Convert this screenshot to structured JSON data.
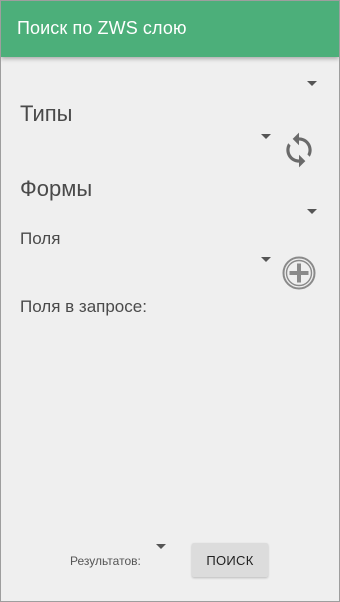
{
  "appbar": {
    "title": "Поиск по ZWS слою"
  },
  "form": {
    "types_label": "Типы",
    "forms_label": "Формы",
    "fields_label": "Поля",
    "query_fields_label": "Поля в запросе:"
  },
  "footer": {
    "results_label": "Результатов:",
    "search_button_label": "поиск"
  },
  "icons": {
    "refresh": "refresh-icon",
    "add": "add-circle-icon"
  },
  "colors": {
    "appbar": "#4caf7a",
    "background": "#efefef",
    "icon": "#666666"
  }
}
